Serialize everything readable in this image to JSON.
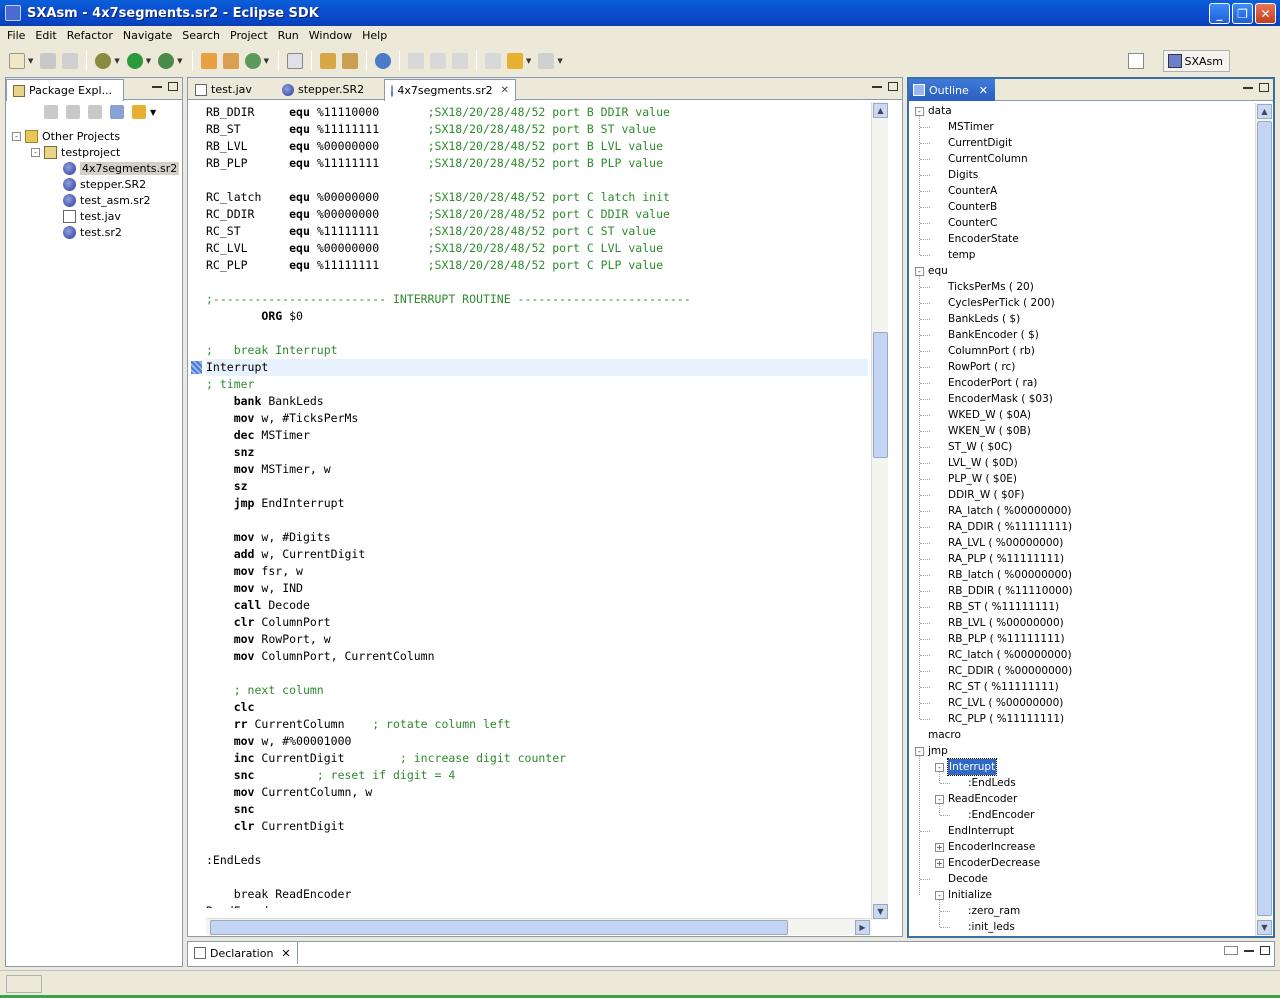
{
  "window": {
    "title": "SXAsm - 4x7segments.sr2 - Eclipse SDK"
  },
  "menu": [
    "File",
    "Edit",
    "Refactor",
    "Navigate",
    "Search",
    "Project",
    "Run",
    "Window",
    "Help"
  ],
  "perspective": {
    "label": "SXAsm"
  },
  "package_explorer": {
    "tab_label": "Package Expl...",
    "tree": [
      {
        "label": "Other Projects",
        "level": 0,
        "icon": "folder-icon",
        "toggle": "-"
      },
      {
        "label": "testproject",
        "level": 1,
        "icon": "project-icon",
        "toggle": "-"
      },
      {
        "label": "4x7segments.sr2",
        "level": 2,
        "icon": "sx-file-icon",
        "selected": true
      },
      {
        "label": "stepper.SR2",
        "level": 2,
        "icon": "sx-file-icon"
      },
      {
        "label": "test_asm.sr2",
        "level": 2,
        "icon": "sx-file-icon"
      },
      {
        "label": "test.jav",
        "level": 2,
        "icon": "java-file-icon"
      },
      {
        "label": "test.sr2",
        "level": 2,
        "icon": "sx-file-icon"
      }
    ]
  },
  "editor": {
    "tabs": [
      {
        "label": "test.jav",
        "active": false
      },
      {
        "label": "stepper.SR2",
        "active": false
      },
      {
        "label": "4x7segments.sr2",
        "active": true
      }
    ],
    "lines": [
      {
        "label": "RB_DDIR",
        "op": "equ",
        "arg": "%11110000",
        "comment": ";SX18/20/28/48/52 port B DDIR value"
      },
      {
        "label": "RB_ST",
        "op": "equ",
        "arg": "%11111111",
        "comment": ";SX18/20/28/48/52 port B ST value"
      },
      {
        "label": "RB_LVL",
        "op": "equ",
        "arg": "%00000000",
        "comment": ";SX18/20/28/48/52 port B LVL value"
      },
      {
        "label": "RB_PLP",
        "op": "equ",
        "arg": "%11111111",
        "comment": ";SX18/20/28/48/52 port B PLP value"
      },
      {},
      {
        "label": "RC_latch",
        "op": "equ",
        "arg": "%00000000",
        "comment": ";SX18/20/28/48/52 port C latch init"
      },
      {
        "label": "RC_DDIR",
        "op": "equ",
        "arg": "%00000000",
        "comment": ";SX18/20/28/48/52 port C DDIR value"
      },
      {
        "label": "RC_ST",
        "op": "equ",
        "arg": "%11111111",
        "comment": ";SX18/20/28/48/52 port C ST value"
      },
      {
        "label": "RC_LVL",
        "op": "equ",
        "arg": "%00000000",
        "comment": ";SX18/20/28/48/52 port C LVL value"
      },
      {
        "label": "RC_PLP",
        "op": "equ",
        "arg": "%11111111",
        "comment": ";SX18/20/28/48/52 port C PLP value"
      },
      {},
      {
        "comment_only": ";------------------------- INTERRUPT ROUTINE -------------------------"
      },
      {
        "indent": 8,
        "op": "ORG",
        "arg": "$0"
      },
      {},
      {
        "comment_only": ";   break Interrupt"
      },
      {
        "label": "Interrupt",
        "highlight": true,
        "breakpoint": true
      },
      {
        "comment_only": "; timer"
      },
      {
        "indent": 4,
        "op": "bank",
        "arg": "BankLeds"
      },
      {
        "indent": 4,
        "op": "mov",
        "arg": "w, #TicksPerMs"
      },
      {
        "indent": 4,
        "op": "dec",
        "arg": "MSTimer"
      },
      {
        "indent": 4,
        "op": "snz"
      },
      {
        "indent": 4,
        "op": "mov",
        "arg": "MSTimer, w"
      },
      {
        "indent": 4,
        "op": "sz"
      },
      {
        "indent": 4,
        "op": "jmp",
        "arg": "EndInterrupt"
      },
      {},
      {
        "indent": 4,
        "op": "mov",
        "arg": "w, #Digits"
      },
      {
        "indent": 4,
        "op": "add",
        "arg": "w, CurrentDigit"
      },
      {
        "indent": 4,
        "op": "mov",
        "arg": "fsr, w"
      },
      {
        "indent": 4,
        "op": "mov",
        "arg": "w, IND"
      },
      {
        "indent": 4,
        "op": "call",
        "arg": "Decode"
      },
      {
        "indent": 4,
        "op": "clr",
        "arg": "ColumnPort"
      },
      {
        "indent": 4,
        "op": "mov",
        "arg": "RowPort, w"
      },
      {
        "indent": 4,
        "op": "mov",
        "arg": "ColumnPort, CurrentColumn"
      },
      {},
      {
        "indent": 4,
        "comment_only": "; next column"
      },
      {
        "indent": 4,
        "op": "clc"
      },
      {
        "indent": 4,
        "op": "rr",
        "arg": "CurrentColumn    ",
        "comment": "; rotate column left"
      },
      {
        "indent": 4,
        "op": "mov",
        "arg": "w, #%00001000"
      },
      {
        "indent": 4,
        "op": "inc",
        "arg": "CurrentDigit        ",
        "comment": "; increase digit counter"
      },
      {
        "indent": 4,
        "op": "snc",
        "arg": "        ",
        "comment": "; reset if digit = 4"
      },
      {
        "indent": 4,
        "op": "mov",
        "arg": "CurrentColumn, w"
      },
      {
        "indent": 4,
        "op": "snc"
      },
      {
        "indent": 4,
        "op": "clr",
        "arg": "CurrentDigit"
      },
      {},
      {
        "label": ":EndLeds"
      },
      {},
      {
        "indent": 4,
        "plain": "break ReadEncoder"
      },
      {
        "label": "ReadEncoder"
      }
    ]
  },
  "outline": {
    "tab_label": "Outline",
    "tree": [
      {
        "label": "data",
        "level": 0,
        "toggle": "-"
      },
      {
        "label": "MSTimer",
        "level": 1
      },
      {
        "label": "CurrentDigit",
        "level": 1
      },
      {
        "label": "CurrentColumn",
        "level": 1
      },
      {
        "label": "Digits",
        "level": 1
      },
      {
        "label": "CounterA",
        "level": 1
      },
      {
        "label": "CounterB",
        "level": 1
      },
      {
        "label": "CounterC",
        "level": 1
      },
      {
        "label": "EncoderState",
        "level": 1
      },
      {
        "label": "temp",
        "level": 1
      },
      {
        "label": "equ",
        "level": 0,
        "toggle": "-"
      },
      {
        "label": "TicksPerMs ( 20)",
        "level": 1
      },
      {
        "label": "CyclesPerTick ( 200)",
        "level": 1
      },
      {
        "label": "BankLeds ( $)",
        "level": 1
      },
      {
        "label": "BankEncoder ( $)",
        "level": 1
      },
      {
        "label": "ColumnPort ( rb)",
        "level": 1
      },
      {
        "label": "RowPort ( rc)",
        "level": 1
      },
      {
        "label": "EncoderPort ( ra)",
        "level": 1
      },
      {
        "label": "EncoderMask ( $03)",
        "level": 1
      },
      {
        "label": "WKED_W ( $0A)",
        "level": 1
      },
      {
        "label": "WKEN_W ( $0B)",
        "level": 1
      },
      {
        "label": "ST_W ( $0C)",
        "level": 1
      },
      {
        "label": "LVL_W ( $0D)",
        "level": 1
      },
      {
        "label": "PLP_W ( $0E)",
        "level": 1
      },
      {
        "label": "DDIR_W ( $0F)",
        "level": 1
      },
      {
        "label": "RA_latch ( %00000000)",
        "level": 1
      },
      {
        "label": "RA_DDIR ( %11111111)",
        "level": 1
      },
      {
        "label": "RA_LVL ( %00000000)",
        "level": 1
      },
      {
        "label": "RA_PLP ( %11111111)",
        "level": 1
      },
      {
        "label": "RB_latch ( %00000000)",
        "level": 1
      },
      {
        "label": "RB_DDIR ( %11110000)",
        "level": 1
      },
      {
        "label": "RB_ST ( %11111111)",
        "level": 1
      },
      {
        "label": "RB_LVL ( %00000000)",
        "level": 1
      },
      {
        "label": "RB_PLP ( %11111111)",
        "level": 1
      },
      {
        "label": "RC_latch ( %00000000)",
        "level": 1
      },
      {
        "label": "RC_DDIR ( %00000000)",
        "level": 1
      },
      {
        "label": "RC_ST ( %11111111)",
        "level": 1
      },
      {
        "label": "RC_LVL ( %00000000)",
        "level": 1
      },
      {
        "label": "RC_PLP ( %11111111)",
        "level": 1
      },
      {
        "label": "macro",
        "level": 0
      },
      {
        "label": "jmp",
        "level": 0,
        "toggle": "-"
      },
      {
        "label": "Interrupt",
        "level": 1,
        "toggle": "-",
        "selected": true
      },
      {
        "label": ":EndLeds",
        "level": 2
      },
      {
        "label": "ReadEncoder",
        "level": 1,
        "toggle": "-"
      },
      {
        "label": ":EndEncoder",
        "level": 2
      },
      {
        "label": "EndInterrupt",
        "level": 1
      },
      {
        "label": "EncoderIncrease",
        "level": 1,
        "toggle": "+"
      },
      {
        "label": "EncoderDecrease",
        "level": 1,
        "toggle": "+"
      },
      {
        "label": "Decode",
        "level": 1
      },
      {
        "label": "Initialize",
        "level": 1,
        "toggle": "-"
      },
      {
        "label": ":zero_ram",
        "level": 2
      },
      {
        "label": ":init_leds",
        "level": 2
      }
    ]
  },
  "declaration": {
    "tab_label": "Declaration"
  }
}
